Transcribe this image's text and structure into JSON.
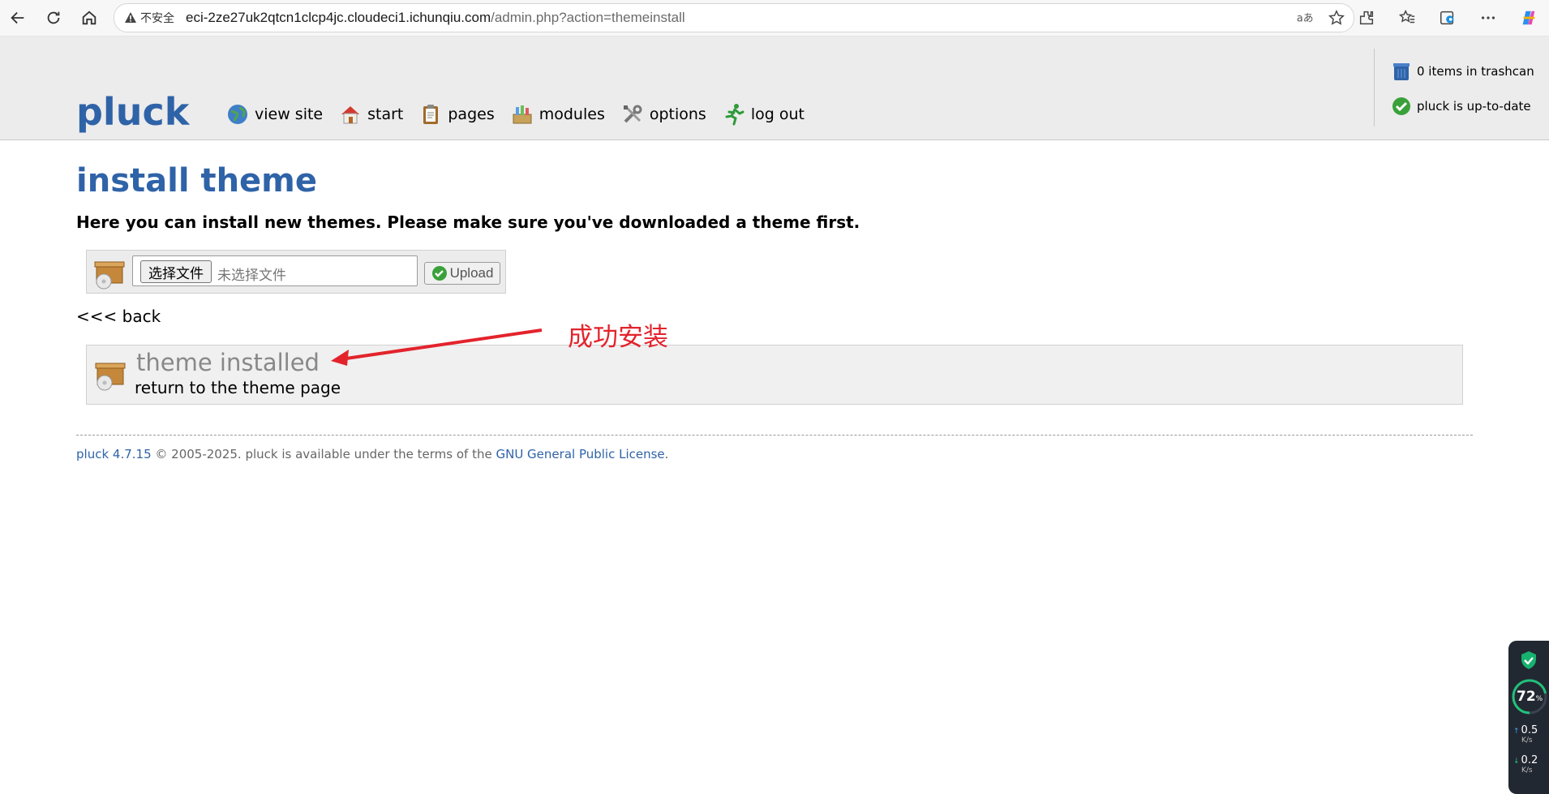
{
  "browser": {
    "security_label": "不安全",
    "url_host": "eci-2ze27uk2qtcn1clcp4jc.cloudeci1.ichunqiu.com",
    "url_path": "/admin.php?action=themeinstall"
  },
  "header": {
    "logo": "pluck",
    "menu": [
      {
        "label": "view site",
        "icon": "globe-icon"
      },
      {
        "label": "start",
        "icon": "home-icon"
      },
      {
        "label": "pages",
        "icon": "clipboard-icon"
      },
      {
        "label": "modules",
        "icon": "modules-icon"
      },
      {
        "label": "options",
        "icon": "tools-icon"
      },
      {
        "label": "log out",
        "icon": "running-man-icon"
      }
    ],
    "trashcan_status": "0 items in trashcan",
    "update_status": "pluck is up-to-date"
  },
  "main": {
    "title": "install theme",
    "intro": "Here you can install new themes. Please make sure you've downloaded a theme first.",
    "file_button_label": "选择文件",
    "file_placeholder": "未选择文件",
    "upload_label": "Upload",
    "back_label": "<<< back",
    "success_title": "theme installed",
    "success_link": "return to the theme page",
    "annotation": "成功安装"
  },
  "footer": {
    "version_link": "pluck 4.7.15",
    "text": " © 2005-2025. pluck is available under the terms of the ",
    "license_link": "GNU General Public License",
    "end": "."
  },
  "widget": {
    "percent": "72",
    "percent_unit": "%",
    "up_value": "0.5",
    "down_value": "0.2",
    "unit": "K/s"
  },
  "colors": {
    "brand": "#2f63a8",
    "annotation": "#e3232c",
    "header_bg": "#ececec"
  }
}
